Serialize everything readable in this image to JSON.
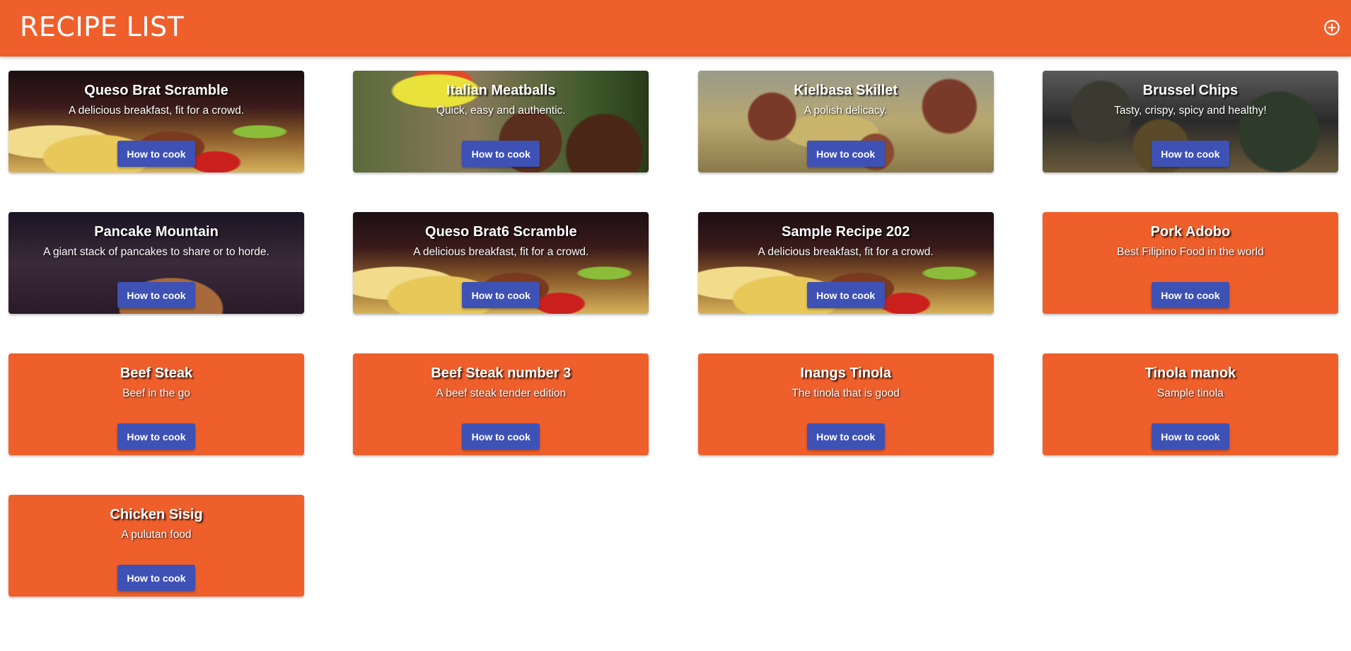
{
  "header": {
    "title": "RECIPE LIST",
    "add_icon": "add-circle-outline-icon"
  },
  "colors": {
    "primary": "#ef5f2c",
    "button": "#3e51b5"
  },
  "recipes": [
    {
      "title": "Queso Brat Scramble",
      "description": "A delicious breakfast, fit for a crowd.",
      "button": "How to cook",
      "image": "scramble"
    },
    {
      "title": "Italian Meatballs",
      "description": "Quick, easy and authentic.",
      "button": "How to cook",
      "image": "meatballs"
    },
    {
      "title": "Kielbasa Skillet",
      "description": "A polish delicacy.",
      "button": "How to cook",
      "image": "kielbasa"
    },
    {
      "title": "Brussel Chips",
      "description": "Tasty, crispy, spicy and healthy!",
      "button": "How to cook",
      "image": "brussel"
    },
    {
      "title": "Pancake Mountain",
      "description": "A giant stack of pancakes to share or to horde.",
      "button": "How to cook",
      "image": "pancake"
    },
    {
      "title": "Queso Brat6 Scramble",
      "description": "A delicious breakfast, fit for a crowd.",
      "button": "How to cook",
      "image": "scramble"
    },
    {
      "title": "Sample Recipe 202",
      "description": "A delicious breakfast, fit for a crowd.",
      "button": "How to cook",
      "image": "scramble"
    },
    {
      "title": "Pork Adobo",
      "description": "Best Filipino Food in the world",
      "button": "How to cook",
      "image": ""
    },
    {
      "title": "Beef Steak",
      "description": "Beef in the go",
      "button": "How to cook",
      "image": ""
    },
    {
      "title": "Beef Steak number 3",
      "description": "A beef steak tender edition",
      "button": "How to cook",
      "image": ""
    },
    {
      "title": "Inangs Tinola",
      "description": "The tinola that is good",
      "button": "How to cook",
      "image": ""
    },
    {
      "title": "Tinola manok",
      "description": "Sample tinola",
      "button": "How to cook",
      "image": ""
    },
    {
      "title": "Chicken Sisig",
      "description": "A pulutan food",
      "button": "How to cook",
      "image": ""
    }
  ]
}
